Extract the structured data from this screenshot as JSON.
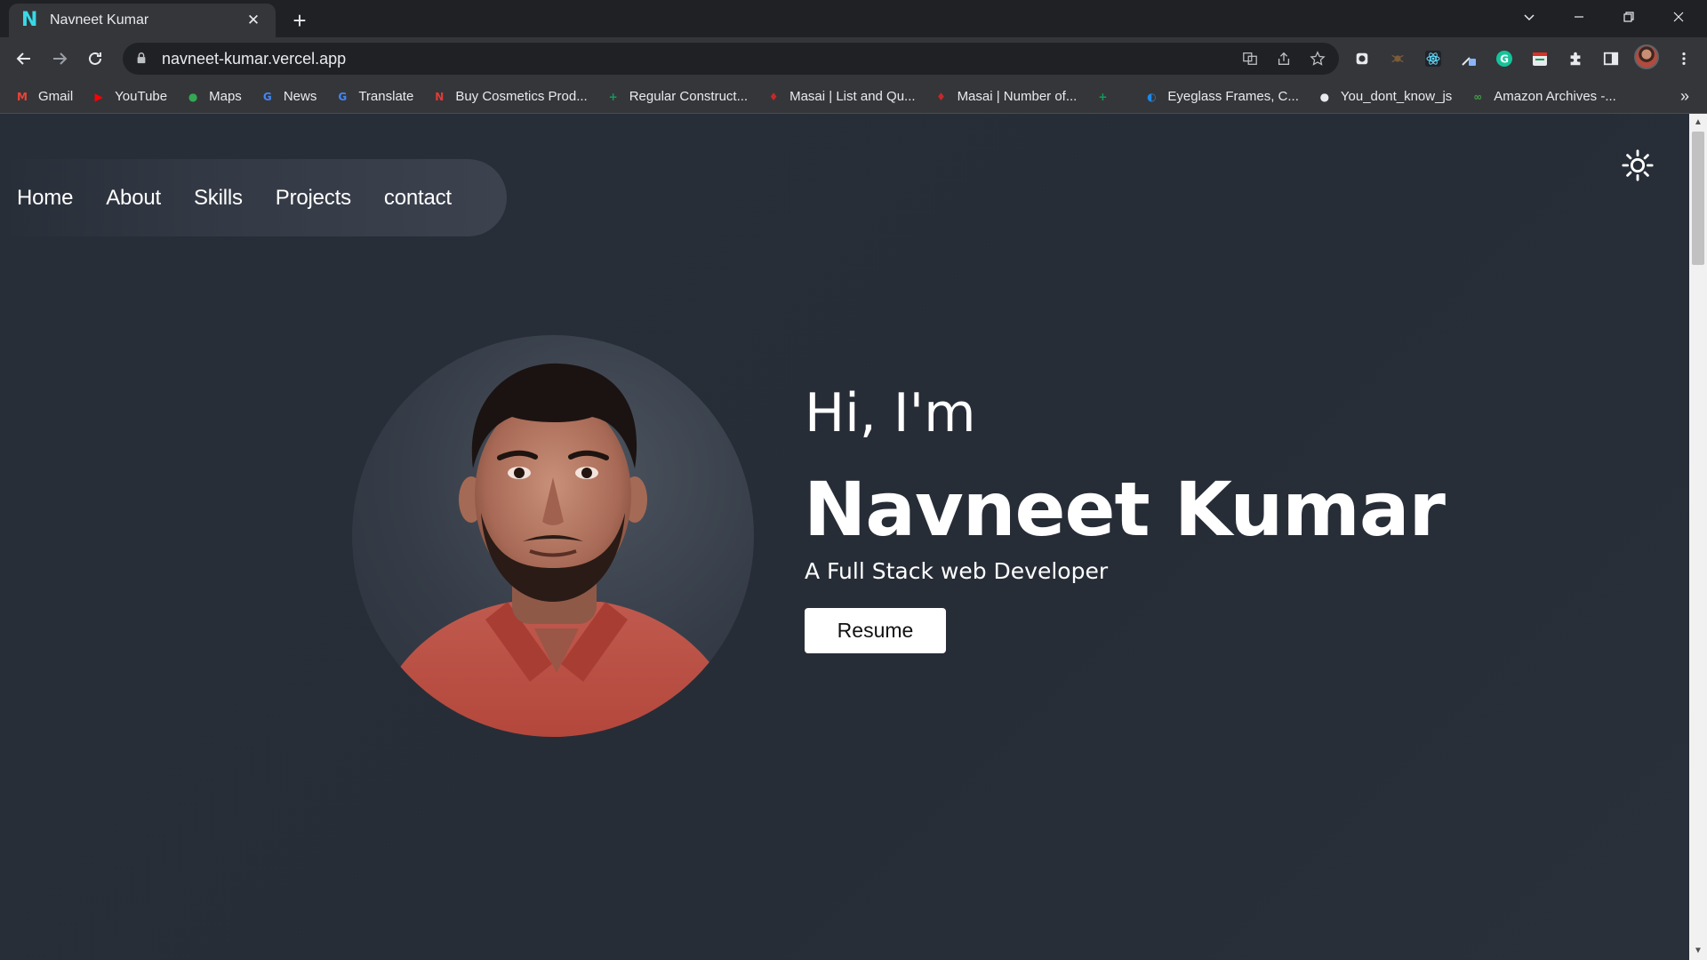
{
  "browser": {
    "tab": {
      "title": "Navneet Kumar",
      "favicon": "N"
    },
    "new_tab_icon": "plus-icon",
    "address": {
      "url": "navneet-kumar.vercel.app"
    },
    "bookmarks": [
      {
        "label": "Gmail",
        "icon": "gmail-icon",
        "color": "#ea4335",
        "glyph": "M"
      },
      {
        "label": "YouTube",
        "icon": "youtube-icon",
        "color": "#ff0000",
        "glyph": "▶"
      },
      {
        "label": "Maps",
        "icon": "maps-icon",
        "color": "#34a853",
        "glyph": "●"
      },
      {
        "label": "News",
        "icon": "news-icon",
        "color": "#4285f4",
        "glyph": "G"
      },
      {
        "label": "Translate",
        "icon": "translate-icon",
        "color": "#4285f4",
        "glyph": "G"
      },
      {
        "label": "Buy Cosmetics Prod...",
        "icon": "cosmetics-icon",
        "color": "#e53935",
        "glyph": "N"
      },
      {
        "label": "Regular Construct...",
        "icon": "sheets-icon",
        "color": "#0f9d58",
        "glyph": "+"
      },
      {
        "label": "Masai | List and Qu...",
        "icon": "masai-icon",
        "color": "#c62828",
        "glyph": "♦"
      },
      {
        "label": "Masai | Number of...",
        "icon": "masai-icon",
        "color": "#c62828",
        "glyph": "♦"
      },
      {
        "label": "",
        "icon": "sheets-icon",
        "color": "#0f9d58",
        "glyph": "+"
      },
      {
        "label": "Eyeglass Frames, C...",
        "icon": "eyeglass-icon",
        "color": "#1e88e5",
        "glyph": "◐"
      },
      {
        "label": "You_dont_know_js",
        "icon": "github-icon",
        "color": "#e8eaed",
        "glyph": "●"
      },
      {
        "label": "Amazon Archives -...",
        "icon": "amazon-icon",
        "color": "#43a047",
        "glyph": "∞"
      }
    ],
    "more_bookmarks": "»"
  },
  "site": {
    "nav": [
      "Home",
      "About",
      "Skills",
      "Projects",
      "contact"
    ],
    "theme_icon": "sun-icon",
    "hero": {
      "greeting": "Hi, I'm",
      "name": "Navneet Kumar",
      "tagline": "A Full Stack web Developer",
      "resume_label": "Resume"
    }
  },
  "colors": {
    "page_background": "#282e38",
    "nav_pill": "#3c424e",
    "accent_favicon": "#38d9e6"
  }
}
